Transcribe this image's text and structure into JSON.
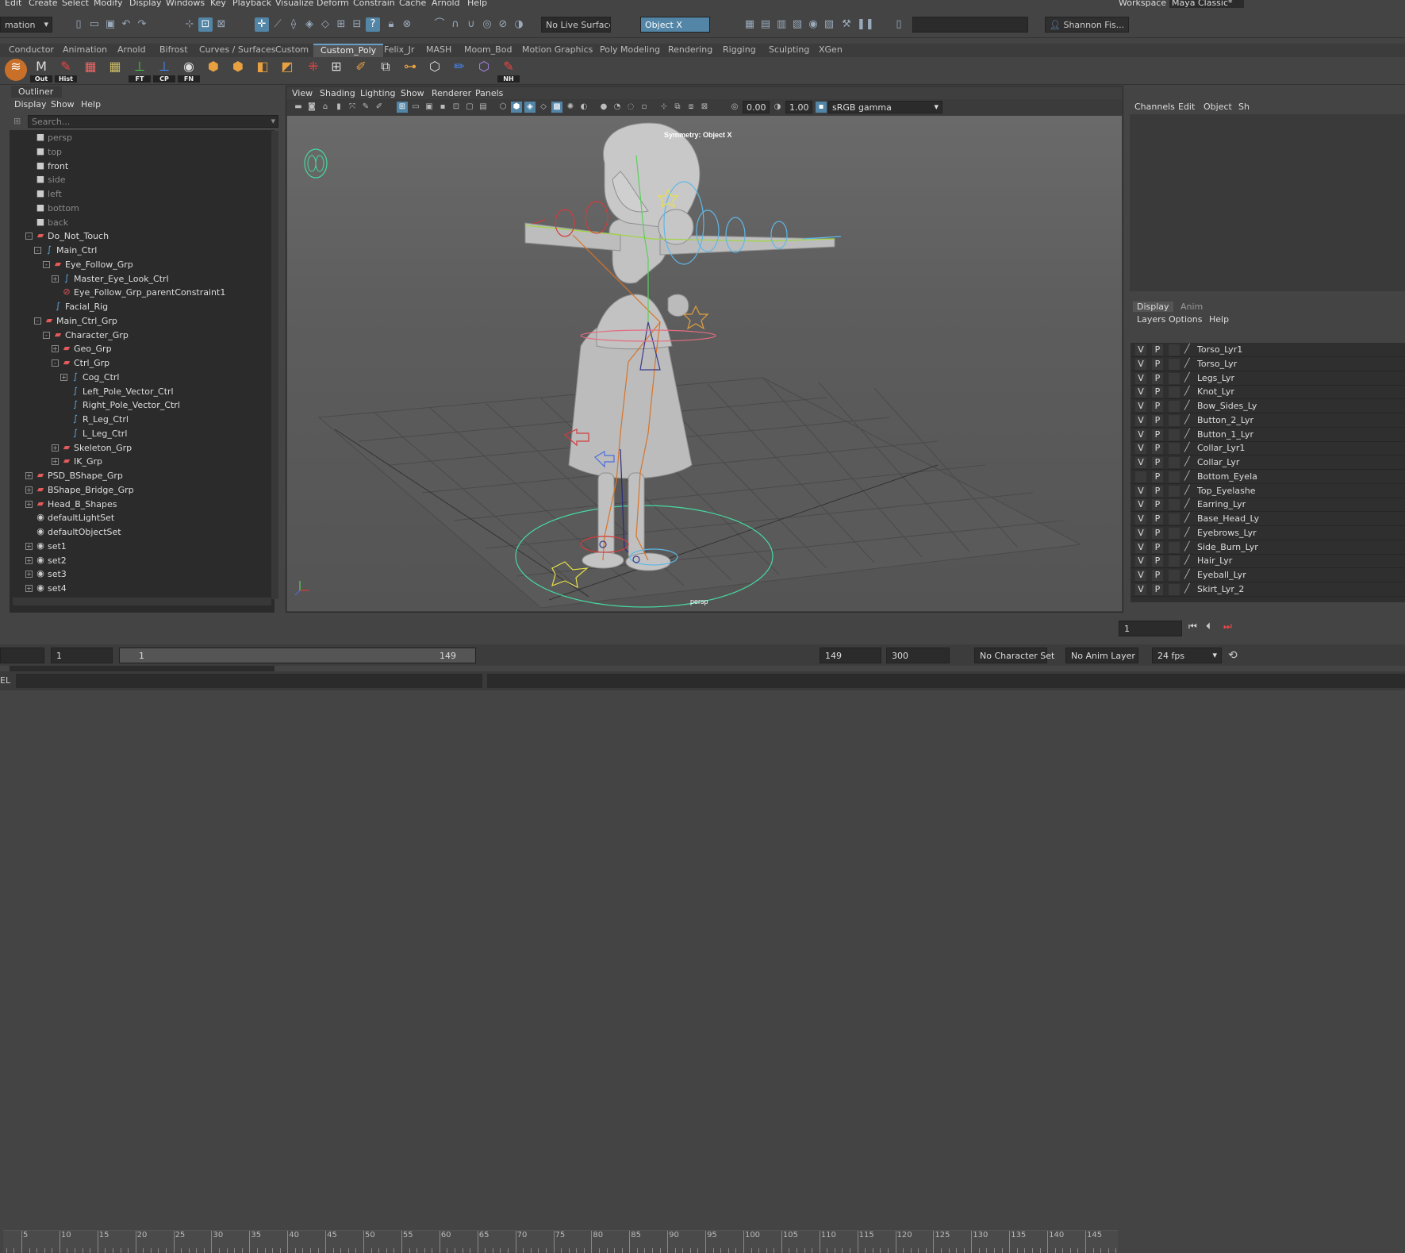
{
  "menu": [
    "Edit",
    "Create",
    "Select",
    "Modify",
    "Display",
    "Windows",
    "Key",
    "Playback",
    "Visualize",
    "Deform",
    "Constrain",
    "Cache",
    "Arnold",
    "Help"
  ],
  "workspace": {
    "label": "Workspace :",
    "value": "Maya Classic*"
  },
  "statusline": {
    "mode": "mation",
    "live_surface": "No Live Surface",
    "symmetry": "Object X",
    "user": "Shannon Fis..."
  },
  "shelf_tabs": [
    "Conductor",
    "Animation",
    "Arnold",
    "Bifrost",
    "Curves / Surfaces",
    "Custom",
    "Custom_Poly",
    "Felix_Jr",
    "MASH",
    "Moom_Bod",
    "Motion Graphics",
    "Poly Modeling",
    "Rendering",
    "Rigging",
    "Sculpting",
    "XGen"
  ],
  "shelf_active": "Custom_Poly",
  "shelf_labels": [
    "Out",
    "Hist",
    "FT",
    "CP",
    "FN",
    "NH"
  ],
  "outliner": {
    "title": "Outliner",
    "menus": [
      "Display",
      "Show",
      "Help"
    ],
    "search_placeholder": "Search...",
    "items": [
      {
        "label": "persp",
        "indent": 0,
        "type": "camera",
        "exp": "",
        "dim": true
      },
      {
        "label": "top",
        "indent": 0,
        "type": "camera",
        "exp": "",
        "dim": true
      },
      {
        "label": "front",
        "indent": 0,
        "type": "camera",
        "exp": "",
        "dim": false
      },
      {
        "label": "side",
        "indent": 0,
        "type": "camera",
        "exp": "",
        "dim": true
      },
      {
        "label": "left",
        "indent": 0,
        "type": "camera",
        "exp": "",
        "dim": true
      },
      {
        "label": "bottom",
        "indent": 0,
        "type": "camera",
        "exp": "",
        "dim": true
      },
      {
        "label": "back",
        "indent": 0,
        "type": "camera",
        "exp": "",
        "dim": true
      },
      {
        "label": "Do_Not_Touch",
        "indent": 0,
        "type": "group",
        "exp": "-",
        "dim": false
      },
      {
        "label": "Main_Ctrl",
        "indent": 1,
        "type": "curve",
        "exp": "-",
        "dim": false
      },
      {
        "label": "Eye_Follow_Grp",
        "indent": 2,
        "type": "group",
        "exp": "-",
        "dim": false
      },
      {
        "label": "Master_Eye_Look_Ctrl",
        "indent": 3,
        "type": "curve",
        "exp": "+",
        "dim": false
      },
      {
        "label": "Eye_Follow_Grp_parentConstraint1",
        "indent": 3,
        "type": "constraint",
        "exp": "",
        "dim": false
      },
      {
        "label": "Facial_Rig",
        "indent": 2,
        "type": "curve",
        "exp": "",
        "dim": false
      },
      {
        "label": "Main_Ctrl_Grp",
        "indent": 1,
        "type": "group",
        "exp": "-",
        "dim": false
      },
      {
        "label": "Character_Grp",
        "indent": 2,
        "type": "group",
        "exp": "-",
        "dim": false
      },
      {
        "label": "Geo_Grp",
        "indent": 3,
        "type": "group",
        "exp": "+",
        "dim": false
      },
      {
        "label": "Ctrl_Grp",
        "indent": 3,
        "type": "group",
        "exp": "-",
        "dim": false
      },
      {
        "label": "Cog_Ctrl",
        "indent": 4,
        "type": "curve",
        "exp": "+",
        "dim": false
      },
      {
        "label": "Left_Pole_Vector_Ctrl",
        "indent": 4,
        "type": "curve",
        "exp": "",
        "dim": false
      },
      {
        "label": "Right_Pole_Vector_Ctrl",
        "indent": 4,
        "type": "curve",
        "exp": "",
        "dim": false
      },
      {
        "label": "R_Leg_Ctrl",
        "indent": 4,
        "type": "curve",
        "exp": "",
        "dim": false
      },
      {
        "label": "L_Leg_Ctrl",
        "indent": 4,
        "type": "curve",
        "exp": "",
        "dim": false
      },
      {
        "label": "Skeleton_Grp",
        "indent": 3,
        "type": "group",
        "exp": "+",
        "dim": false
      },
      {
        "label": "IK_Grp",
        "indent": 3,
        "type": "group",
        "exp": "+",
        "dim": false
      },
      {
        "label": "PSD_BShape_Grp",
        "indent": 0,
        "type": "group",
        "exp": "+",
        "dim": false
      },
      {
        "label": "BShape_Bridge_Grp",
        "indent": 0,
        "type": "group",
        "exp": "+",
        "dim": false
      },
      {
        "label": "Head_B_Shapes",
        "indent": 0,
        "type": "group",
        "exp": "+",
        "dim": false
      },
      {
        "label": "defaultLightSet",
        "indent": 0,
        "type": "set",
        "exp": "",
        "dim": false
      },
      {
        "label": "defaultObjectSet",
        "indent": 0,
        "type": "set",
        "exp": "",
        "dim": false
      },
      {
        "label": "set1",
        "indent": 0,
        "type": "set",
        "exp": "+",
        "dim": false
      },
      {
        "label": "set2",
        "indent": 0,
        "type": "set",
        "exp": "+",
        "dim": false
      },
      {
        "label": "set3",
        "indent": 0,
        "type": "set",
        "exp": "+",
        "dim": false
      },
      {
        "label": "set4",
        "indent": 0,
        "type": "set",
        "exp": "+",
        "dim": false
      }
    ]
  },
  "viewport": {
    "menus": [
      "View",
      "Shading",
      "Lighting",
      "Show",
      "Renderer",
      "Panels"
    ],
    "exposure": "0.00",
    "gamma": "1.00",
    "colorspace": "sRGB gamma",
    "symmetry_label": "Symmetry: Object X",
    "camera_label": "persp"
  },
  "channelbox": {
    "menus": [
      "Channels",
      "Edit",
      "Object",
      "Sh"
    ],
    "layer_tabs": [
      "Display",
      "Anim"
    ],
    "layer_menus": [
      "Layers",
      "Options",
      "Help"
    ]
  },
  "layers": [
    {
      "v": "V",
      "p": "P",
      "name": "Torso_Lyr1"
    },
    {
      "v": "V",
      "p": "P",
      "name": "Torso_Lyr"
    },
    {
      "v": "V",
      "p": "P",
      "name": "Legs_Lyr"
    },
    {
      "v": "V",
      "p": "P",
      "name": "Knot_Lyr"
    },
    {
      "v": "V",
      "p": "P",
      "name": "Bow_Sides_Ly"
    },
    {
      "v": "V",
      "p": "P",
      "name": "Button_2_Lyr"
    },
    {
      "v": "V",
      "p": "P",
      "name": "Button_1_Lyr"
    },
    {
      "v": "V",
      "p": "P",
      "name": "Collar_Lyr1"
    },
    {
      "v": "V",
      "p": "P",
      "name": "Collar_Lyr"
    },
    {
      "v": "",
      "p": "P",
      "name": "Bottom_Eyela"
    },
    {
      "v": "V",
      "p": "P",
      "name": "Top_Eyelashe"
    },
    {
      "v": "V",
      "p": "P",
      "name": "Earring_Lyr"
    },
    {
      "v": "V",
      "p": "P",
      "name": "Base_Head_Ly"
    },
    {
      "v": "V",
      "p": "P",
      "name": "Eyebrows_Lyr"
    },
    {
      "v": "V",
      "p": "P",
      "name": "Side_Burn_Lyr"
    },
    {
      "v": "V",
      "p": "P",
      "name": "Hair_Lyr"
    },
    {
      "v": "V",
      "p": "P",
      "name": "Eyeball_Lyr"
    },
    {
      "v": "V",
      "p": "P",
      "name": "Skirt_Lyr_2"
    }
  ],
  "timeline": {
    "ticks": [
      5,
      10,
      15,
      20,
      25,
      30,
      35,
      40,
      45,
      50,
      55,
      60,
      65,
      70,
      75,
      80,
      85,
      90,
      95,
      100,
      105,
      110,
      115,
      120,
      125,
      130,
      135,
      140,
      145
    ],
    "current_frame": "1"
  },
  "range": {
    "start": "1",
    "inner_start": "1",
    "inner_end": "149",
    "end": "149",
    "anim_end": "300",
    "character_set": "No Character Set",
    "anim_layer": "No Anim Layer",
    "fps": "24 fps"
  },
  "cmdline": {
    "prefix": "EL"
  }
}
